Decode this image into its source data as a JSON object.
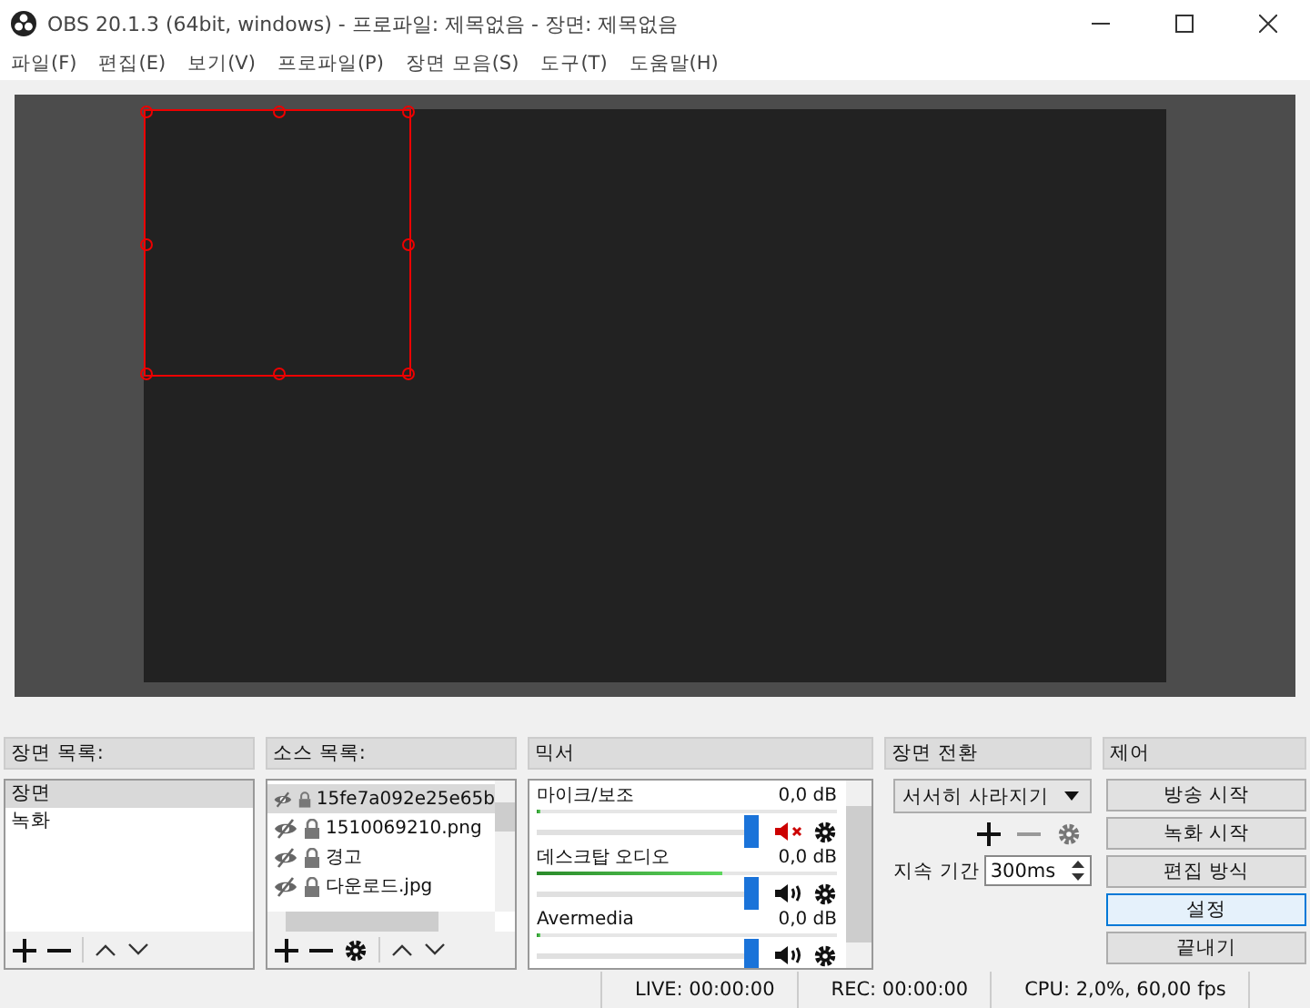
{
  "window": {
    "title": "OBS 20.1.3 (64bit, windows) - 프로파일: 제목없음 - 장면: 제목없음"
  },
  "menu": [
    "파일(F)",
    "편집(E)",
    "보기(V)",
    "프로파일(P)",
    "장면 모음(S)",
    "도구(T)",
    "도움말(H)"
  ],
  "scenes": {
    "title": "장면 목록:",
    "items": [
      {
        "label": "장면",
        "selected": true
      },
      {
        "label": "녹화",
        "selected": false
      }
    ]
  },
  "sources": {
    "title": "소스 목록:",
    "items": [
      {
        "label": "15fe7a092e25e65b",
        "selected": true
      },
      {
        "label": "1510069210.png",
        "selected": false
      },
      {
        "label": "경고",
        "selected": false
      },
      {
        "label": "다운로드.jpg",
        "selected": false
      }
    ]
  },
  "mixer": {
    "title": "믹서",
    "channels": [
      {
        "name": "마이크/보조",
        "reading": "0,0 dB",
        "muted": true,
        "meter": {
          "level": 0
        },
        "fader": {
          "level": 1
        }
      },
      {
        "name": "데스크탑 오디오",
        "reading": "0,0 dB",
        "muted": false,
        "meter": {
          "level": 0.62
        },
        "fader": {
          "level": 1
        }
      },
      {
        "name": "Avermedia",
        "reading": "0,0 dB",
        "muted": false,
        "meter": {
          "level": 0
        },
        "fader": {
          "level": 1
        }
      }
    ]
  },
  "transitions": {
    "title": "장면 전환",
    "transition": "서서히 사라지기",
    "duration_label": "지속 기간",
    "duration": "300ms"
  },
  "controls": {
    "title": "제어",
    "buttons": [
      {
        "label": "방송 시작",
        "focused": false
      },
      {
        "label": "녹화 시작",
        "focused": false
      },
      {
        "label": "편집 방식",
        "focused": false
      },
      {
        "label": "설정",
        "focused": true
      },
      {
        "label": "끝내기",
        "focused": false
      }
    ]
  },
  "status": {
    "live": "LIVE: 00:00:00",
    "rec": "REC: 00:00:00",
    "cpu": "CPU: 2,0%, 60,00 fps"
  }
}
